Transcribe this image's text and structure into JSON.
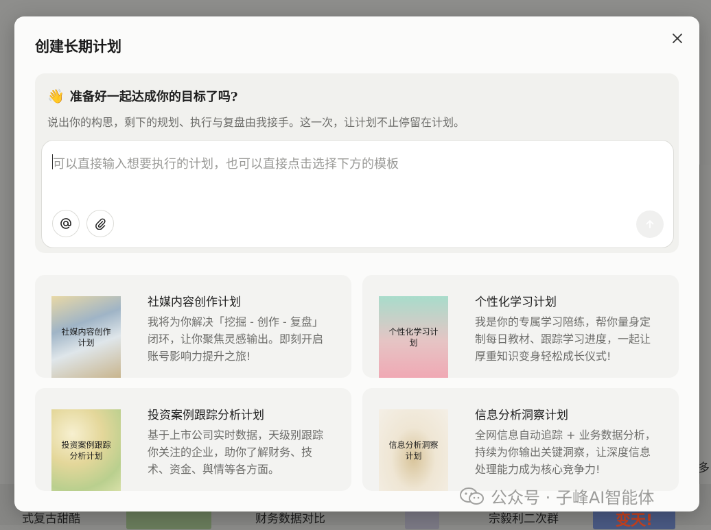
{
  "background": {
    "items": [
      {
        "label": "式复古甜酷"
      },
      {
        "label": "财务数据对比"
      },
      {
        "label": "宗毅利二次群"
      },
      {
        "label": "变天!"
      }
    ],
    "edge_char": "多"
  },
  "modal": {
    "title": "创建长期计划",
    "close_icon": "close-icon",
    "hero": {
      "emoji": "👋",
      "title": "准备好一起达成你的目标了吗?",
      "subtitle": "说出你的构思，剩下的规划、执行与复盘由我接手。这一次，让计划不止停留在计划。",
      "input_placeholder": "可以直接输入想要执行的计划，也可以直接点击选择下方的模板",
      "tools": [
        "at-icon",
        "paperclip-icon"
      ],
      "send_icon": "arrow-up-icon"
    },
    "templates": [
      {
        "title": "社媒内容创作计划",
        "thumb_text": "社媒内容创作计划",
        "desc": "我将为你解决「挖掘 - 创作 - 复盘」闭环，让你聚焦灵感输出。即刻开启账号影响力提升之旅!"
      },
      {
        "title": "个性化学习计划",
        "thumb_text": "个性化学习计划",
        "desc": "我是你的专属学习陪练，帮你量身定制每日教材、跟踪学习进度，一起让厚重知识变身轻松成长仪式!"
      },
      {
        "title": "投资案例跟踪分析计划",
        "thumb_text": "投资案例跟踪分析计划",
        "desc": "基于上市公司实时数据，天级别跟踪你关注的企业，助你了解财务、技术、资金、舆情等各方面。"
      },
      {
        "title": "信息分析洞察计划",
        "thumb_text": "信息分析洞察计划",
        "desc": "全网信息自动追踪 + 业务数据分析，持续为你输出关键洞察，让深度信息处理能力成为核心竞争力!"
      }
    ]
  },
  "watermark": {
    "text": "公众号 · 子峰AI智能体",
    "icon": "wechat-icon"
  },
  "colors": {
    "modal_bg": "#fbfbfa",
    "hero_bg": "#f1f1ee",
    "card_bg": "#f3f3f1",
    "overlay": "#8c8c8a"
  }
}
